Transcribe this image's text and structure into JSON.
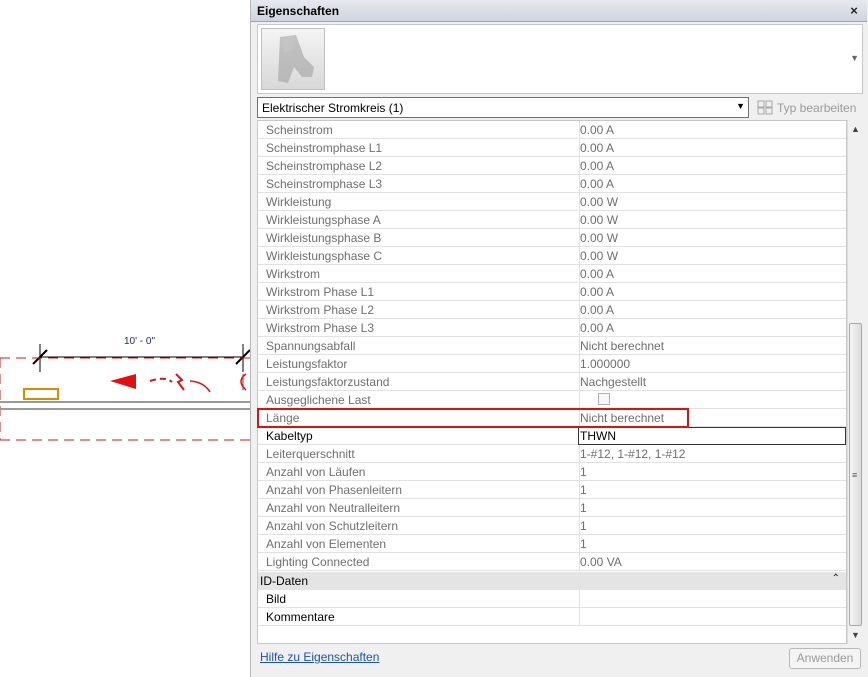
{
  "canvas": {
    "dimension_label": "10' - 0\""
  },
  "panel": {
    "title": "Eigenschaften",
    "close_glyph": "×",
    "type_selector": "Elektrischer Stromkreis (1)",
    "edit_type_label": "Typ bearbeiten",
    "help_link": "Hilfe zu Eigenschaften",
    "apply_label": "Anwenden"
  },
  "properties": [
    {
      "name": "Scheinstrom",
      "value": "0.00 A"
    },
    {
      "name": "Scheinstromphase L1",
      "value": "0.00 A"
    },
    {
      "name": "Scheinstromphase L2",
      "value": "0.00 A"
    },
    {
      "name": "Scheinstromphase L3",
      "value": "0.00 A"
    },
    {
      "name": "Wirkleistung",
      "value": "0.00 W"
    },
    {
      "name": "Wirkleistungsphase A",
      "value": "0.00 W"
    },
    {
      "name": "Wirkleistungsphase B",
      "value": "0.00 W"
    },
    {
      "name": "Wirkleistungsphase C",
      "value": "0.00 W"
    },
    {
      "name": "Wirkstrom",
      "value": "0.00 A"
    },
    {
      "name": "Wirkstrom Phase L1",
      "value": "0.00 A"
    },
    {
      "name": "Wirkstrom Phase L2",
      "value": "0.00 A"
    },
    {
      "name": "Wirkstrom Phase L3",
      "value": "0.00 A"
    },
    {
      "name": "Spannungsabfall",
      "value": "Nicht berechnet"
    },
    {
      "name": "Leistungsfaktor",
      "value": "1.000000"
    },
    {
      "name": "Leistungsfaktorzustand",
      "value": "Nachgestellt"
    },
    {
      "name": "Ausgeglichene Last",
      "value": ""
    },
    {
      "name": "Länge",
      "value": "Nicht berechnet"
    },
    {
      "name": "Kabeltyp",
      "value": "THWN"
    },
    {
      "name": "Leiterquerschnitt",
      "value": "1-#12, 1-#12, 1-#12"
    },
    {
      "name": "Anzahl von Läufen",
      "value": "1"
    },
    {
      "name": "Anzahl von Phasenleitern",
      "value": "1"
    },
    {
      "name": "Anzahl von Neutralleitern",
      "value": "1"
    },
    {
      "name": "Anzahl von Schutzleitern",
      "value": "1"
    },
    {
      "name": "Anzahl von Elementen",
      "value": "1"
    },
    {
      "name": "Lighting Connected",
      "value": "0.00 VA"
    }
  ],
  "section": {
    "label": "ID-Daten",
    "collapse_glyph": "⌃",
    "rows": [
      {
        "name": "Bild",
        "value": ""
      },
      {
        "name": "Kommentare",
        "value": ""
      }
    ]
  },
  "colors": {
    "highlight": "#e01010",
    "circuit": "#e01010",
    "device": "#e08a00",
    "link": "#1a52b8"
  }
}
